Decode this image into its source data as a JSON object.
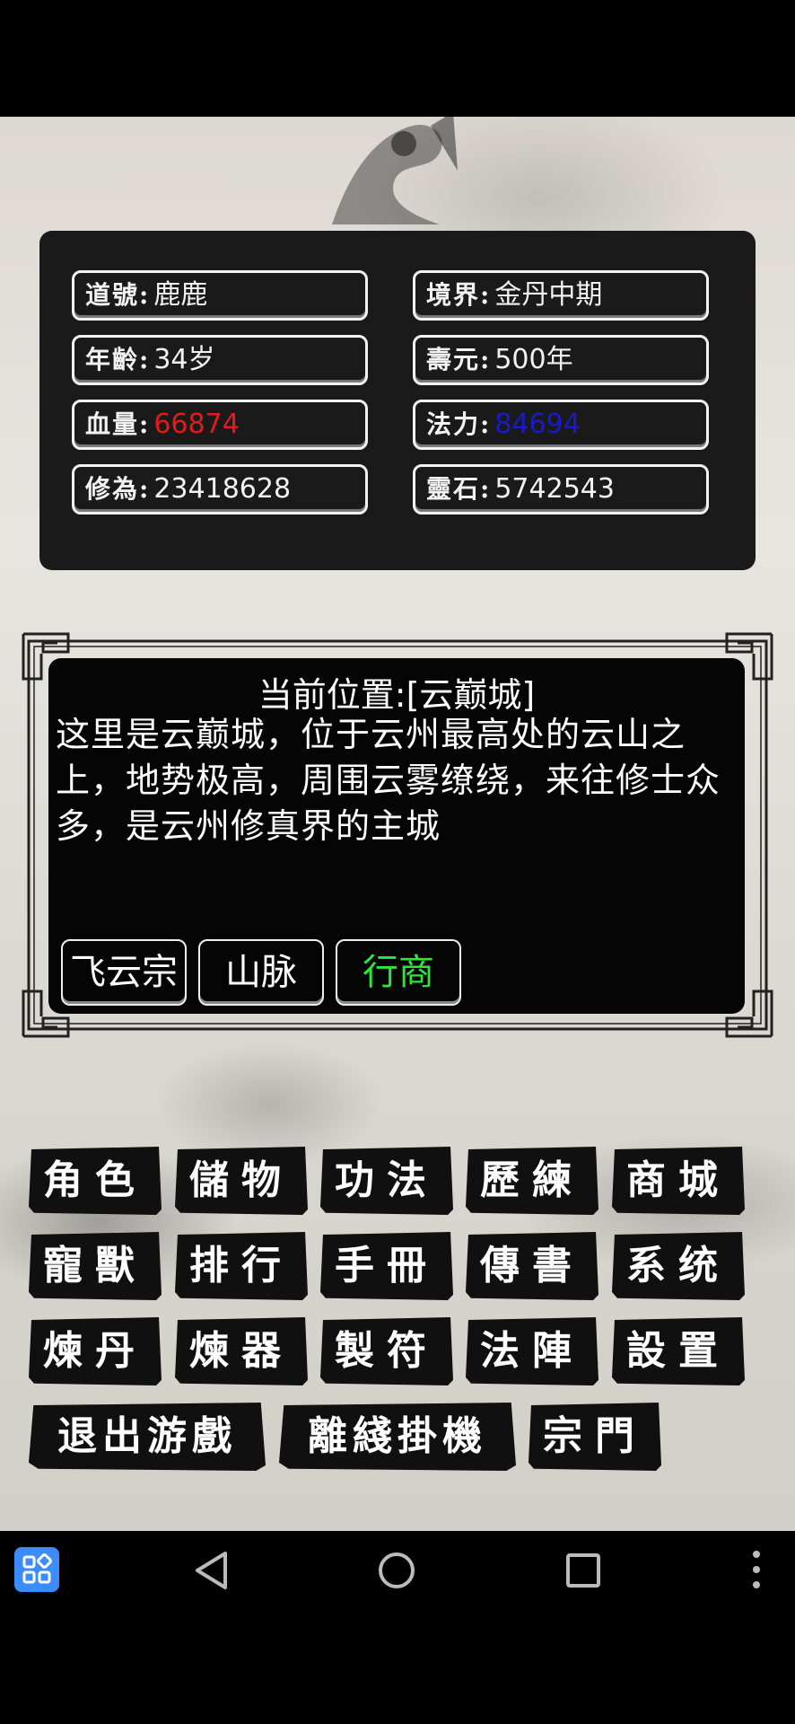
{
  "player_stats": [
    {
      "key": "dao_name",
      "label": "道號:",
      "value": "鹿鹿"
    },
    {
      "key": "realm",
      "label": "境界:",
      "value": "金丹中期"
    },
    {
      "key": "age",
      "label": "年齡:",
      "value": "34岁"
    },
    {
      "key": "lifespan",
      "label": "壽元:",
      "value": "500年"
    },
    {
      "key": "hp",
      "label": "血量:",
      "value": "66874"
    },
    {
      "key": "mana",
      "label": "法力:",
      "value": "84694"
    },
    {
      "key": "cultivation",
      "label": "修為:",
      "value": "23418628"
    },
    {
      "key": "spirit_stones",
      "label": "靈石:",
      "value": "5742543"
    }
  ],
  "colors": {
    "hp": "#e31b1b",
    "mana": "#1a1acc",
    "merchant": "#2ee63a"
  },
  "location": {
    "title": "当前位置:[云巅城]",
    "description": "这里是云巅城，位于云州最高处的云山之上，地势极高，周围云雾缭绕，来往修士众多，是云州修真界的主城",
    "destinations": [
      {
        "label": "飞云宗"
      },
      {
        "label": "山脉"
      },
      {
        "label": "行商"
      }
    ]
  },
  "menu": [
    {
      "label": "角色"
    },
    {
      "label": "儲物"
    },
    {
      "label": "功法"
    },
    {
      "label": "歷練"
    },
    {
      "label": "商城"
    },
    {
      "label": "寵獸"
    },
    {
      "label": "排行"
    },
    {
      "label": "手冊"
    },
    {
      "label": "傳書"
    },
    {
      "label": "系统"
    },
    {
      "label": "煉丹"
    },
    {
      "label": "煉器"
    },
    {
      "label": "製符"
    },
    {
      "label": "法陣"
    },
    {
      "label": "設置"
    },
    {
      "label": "退出游戲"
    },
    {
      "label": "離綫掛機"
    },
    {
      "label": "宗門"
    }
  ],
  "navbar": {
    "icons": [
      "apps-icon",
      "back-icon",
      "home-icon",
      "recents-icon",
      "more-icon"
    ]
  }
}
